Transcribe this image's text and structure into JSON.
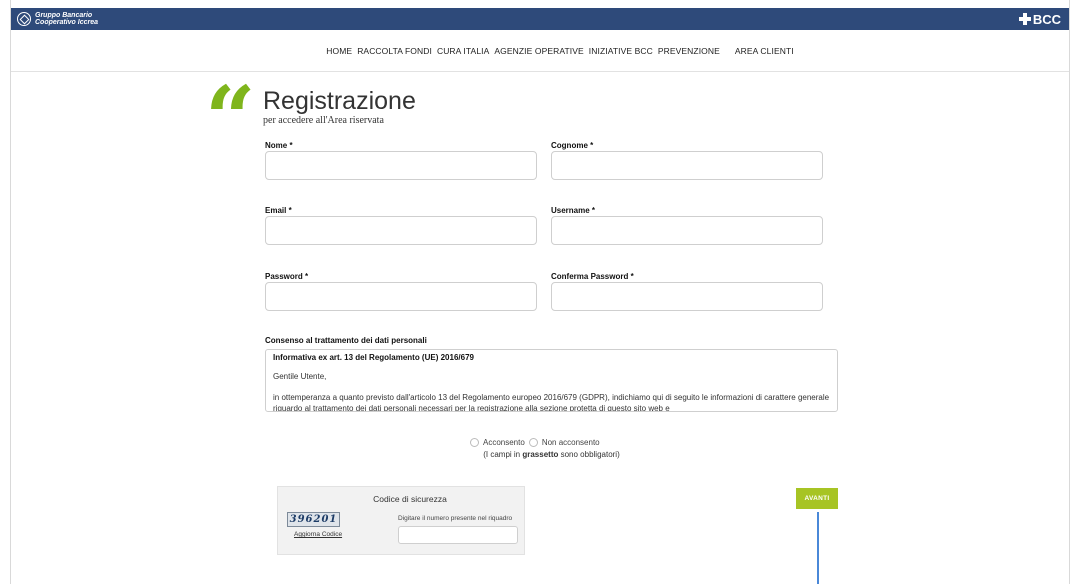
{
  "header": {
    "brand_left_line1": "Gruppo Bancario",
    "brand_left_line2": "Cooperativo Iccrea",
    "brand_right": "BCC",
    "bar_color": "#2e4a7a"
  },
  "nav": {
    "items": [
      {
        "label": "HOME"
      },
      {
        "label": "RACCOLTA FONDI"
      },
      {
        "label": "CURA ITALIA"
      },
      {
        "label": "AGENZIE OPERATIVE"
      },
      {
        "label": "INIZIATIVE BCC"
      },
      {
        "label": "PREVENZIONE"
      },
      {
        "label": "AREA CLIENTI"
      }
    ]
  },
  "page": {
    "quote_mark": "“",
    "title": "Registrazione",
    "subtitle": "per accedere all'Area riservata",
    "accent_color": "#7fb51c"
  },
  "form": {
    "nome_label": "Nome *",
    "cognome_label": "Cognome *",
    "email_label": "Email *",
    "username_label": "Username *",
    "password_label": "Password *",
    "conferma_label": "Conferma Password *",
    "nome_value": "",
    "cognome_value": "",
    "email_value": "",
    "username_value": "",
    "password_value": "",
    "conferma_value": ""
  },
  "consent": {
    "title": "Consenso al trattamento dei dati personali",
    "heading": "Informativa ex art. 13 del Regolamento (UE) 2016/679",
    "greeting": "Gentile Utente,",
    "body": "in ottemperanza a quanto previsto dall'articolo 13 del Regolamento europeo 2016/679 (GDPR), indichiamo qui di seguito le informazioni di carattere generale riguardo al trattamento dei dati personali necessari per la registrazione alla sezione protetta di questo sito web e",
    "option_yes": "Acconsento",
    "option_no": "Non acconsento",
    "note_prefix": "(I campi in ",
    "note_bold": "grassetto",
    "note_suffix": " sono obbligatori)"
  },
  "captcha": {
    "title": "Codice di sicurezza",
    "code": "396201",
    "refresh_label": "Aggiorna Codice",
    "hint": "Digitare il numero presente nel riquadro",
    "value": ""
  },
  "actions": {
    "submit_label": "AVANTI",
    "submit_color": "#a7c424"
  }
}
